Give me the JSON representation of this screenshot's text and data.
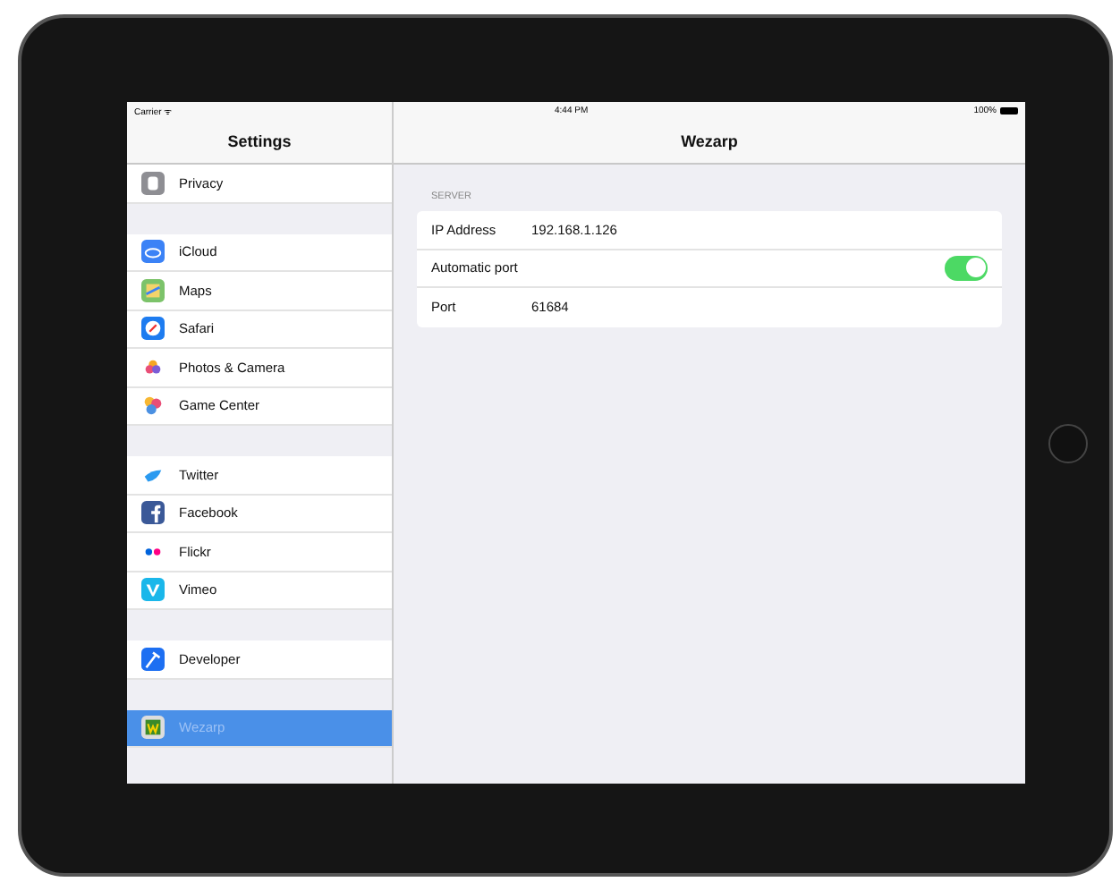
{
  "status_bar": {
    "carrier": "Carrier ᯤ",
    "time": "4:44 PM",
    "battery": "100%"
  },
  "sidebar": {
    "title": "Settings",
    "groups": [
      {
        "items": [
          {
            "label": "Privacy",
            "selected": false
          }
        ]
      },
      {
        "items": [
          {
            "label": "iCloud",
            "selected": false
          },
          {
            "label": "Maps",
            "selected": false
          },
          {
            "label": "Safari",
            "selected": false
          },
          {
            "label": "Photos & Camera",
            "selected": false
          },
          {
            "label": "Game Center",
            "selected": false
          }
        ]
      },
      {
        "items": [
          {
            "label": "Twitter",
            "selected": false
          },
          {
            "label": "Facebook",
            "selected": false
          },
          {
            "label": "Flickr",
            "selected": false
          },
          {
            "label": "Vimeo",
            "selected": false
          }
        ]
      },
      {
        "items": [
          {
            "label": "Developer",
            "selected": false
          }
        ]
      },
      {
        "items": [
          {
            "label": "Wezarp",
            "selected": true
          }
        ]
      }
    ]
  },
  "detail": {
    "title": "Wezarp",
    "section": "SERVER",
    "rows": [
      {
        "kind": "value",
        "label": "IP Address",
        "value": "192.168.1.126"
      },
      {
        "kind": "toggle",
        "label": "Automatic port",
        "on": true
      },
      {
        "kind": "value",
        "label": "Port",
        "value": "61684"
      }
    ]
  }
}
